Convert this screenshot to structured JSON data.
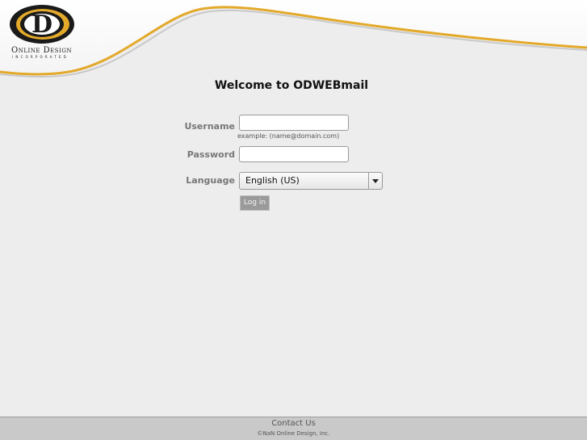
{
  "brand": {
    "logo_name": "Online Design",
    "logo_sub": "INCORPORATED",
    "logo_letter": "D",
    "accent_color": "#e3a92a"
  },
  "main": {
    "welcome": "Welcome to ODWEBmail"
  },
  "form": {
    "username_label": "Username",
    "username_value": "",
    "username_hint": "example: (name@domain.com)",
    "password_label": "Password",
    "password_value": "",
    "language_label": "Language",
    "language_selected": "English (US)",
    "login_label": "Log in"
  },
  "footer": {
    "contact": "Contact Us",
    "copyright": "©NaN Online Design, Inc."
  }
}
